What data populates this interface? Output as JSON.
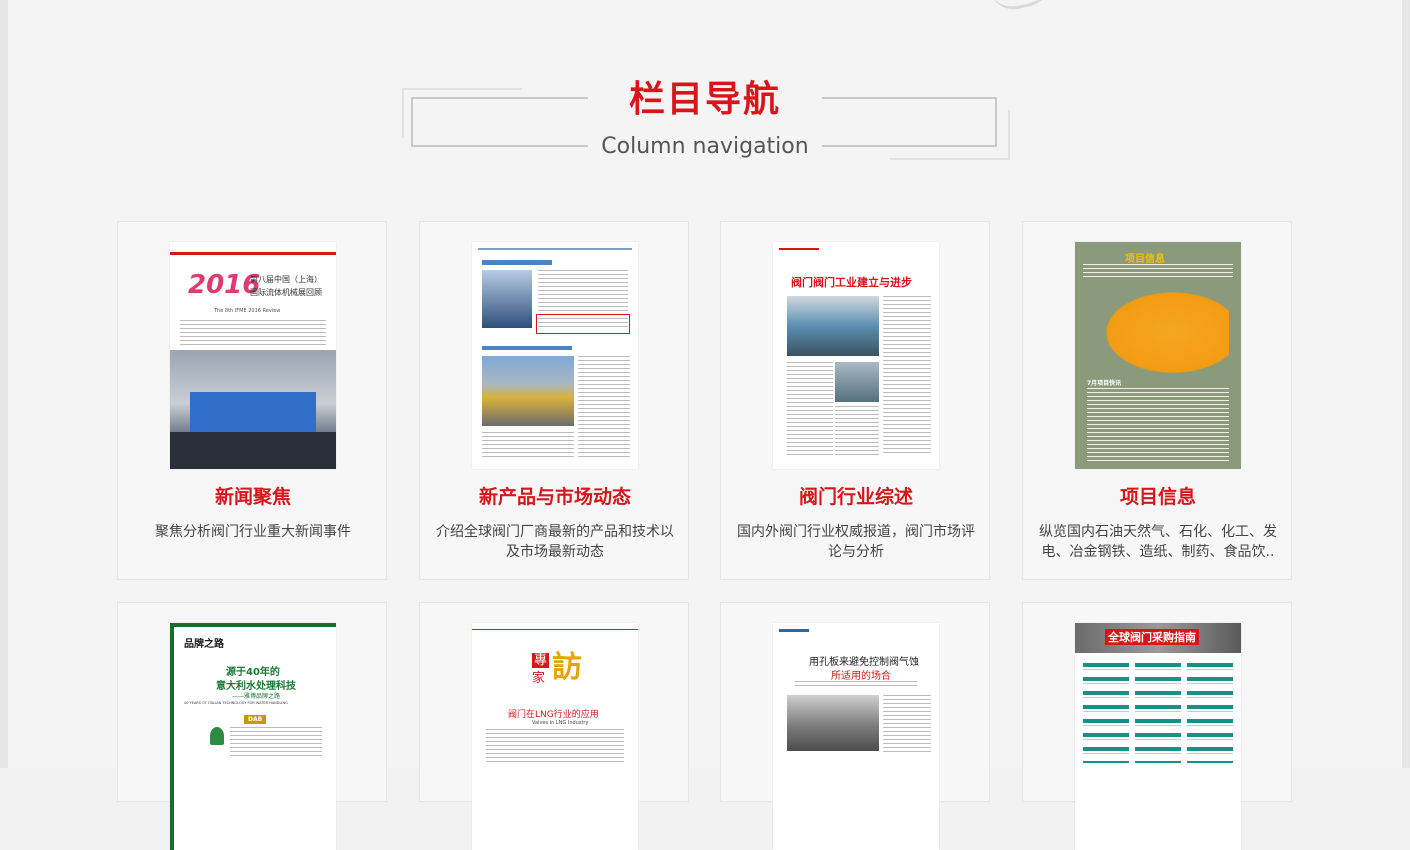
{
  "heading": {
    "title_cn": "栏目导航",
    "title_en": "Column navigation"
  },
  "cards": [
    {
      "title": "新闻聚焦",
      "desc": "聚焦分析阀门行业重大新闻事件",
      "thumb": {
        "big": "2016",
        "line1": "第八届中国（上海）",
        "line2": "国际流体机械展回顾",
        "sub": "The 8th IFME 2016 Review"
      }
    },
    {
      "title": "新产品与市场动态",
      "desc": "介绍全球阀门厂商最新的产品和技术以及市场最新动态",
      "thumb": {}
    },
    {
      "title": "阀门行业综述",
      "desc": "国内外阀门行业权威报道，阀门市场评论与分析",
      "thumb": {
        "headline": "阀门阀门工业建立与进步"
      }
    },
    {
      "title": "项目信息",
      "desc": "纵览国内石油天然气、石化、化工、发电、冶金钢铁、造纸、制药、食品饮..",
      "thumb": {
        "label": "项目信息",
        "sub": "7月项目快讯"
      }
    },
    {
      "title": "",
      "desc": "",
      "thumb": {
        "brand": "品牌之路",
        "line1": "源于40年的",
        "line2": "意大利水处理科技",
        "line3": "——雅博品牌之路",
        "en": "40 YEARS OF ITALIAN TECHNOLOGY FOR WATER HANDLING",
        "logo": "DAB"
      }
    },
    {
      "title": "",
      "desc": "",
      "thumb": {
        "stamp1": "專",
        "stamp2": "家",
        "stamp3": "訪",
        "headline": "阀门在LNG行业的应用",
        "en": "Valves in LNG Industry"
      }
    },
    {
      "title": "",
      "desc": "",
      "thumb": {
        "headline": "用孔板来避免控制阀气蚀",
        "line2": "所适用的场合"
      }
    },
    {
      "title": "",
      "desc": "",
      "thumb": {
        "headline": "全球阀门采购指南"
      }
    }
  ],
  "colors": {
    "accent": "#d7161c",
    "text": "#444444",
    "subtitle": "#555555"
  }
}
